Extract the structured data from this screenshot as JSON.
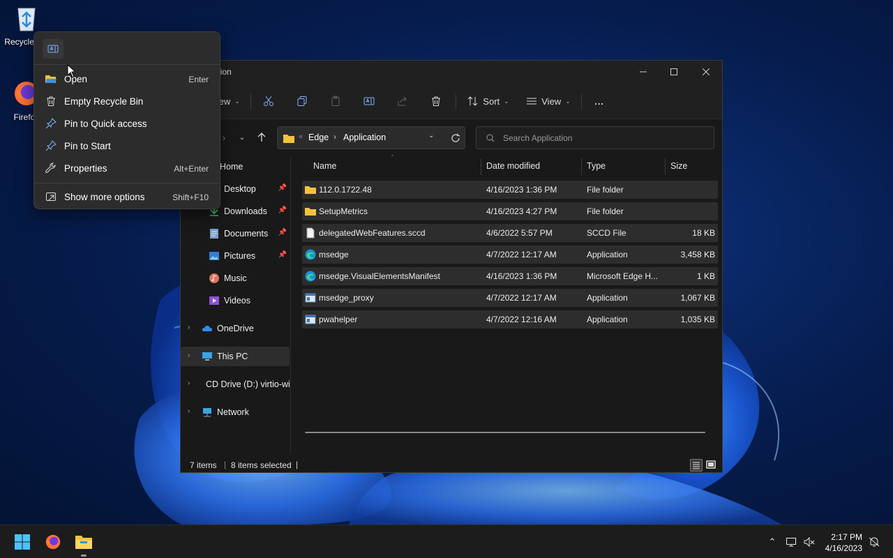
{
  "desktop": {
    "icons": [
      {
        "label": "Recycle Bin",
        "icon": "recycle-bin-icon"
      },
      {
        "label": "Firefox",
        "icon": "firefox-icon"
      }
    ]
  },
  "window": {
    "title": "Application",
    "minimize_icon": "minimize-icon",
    "maximize_icon": "maximize-icon",
    "close_icon": "close-icon"
  },
  "toolbar": {
    "new_label": "New",
    "sort_label": "Sort",
    "view_label": "View",
    "more_label": "..."
  },
  "address": {
    "overflow": "«",
    "crumbs": [
      "Edge",
      "Application"
    ],
    "separator": "›"
  },
  "search": {
    "placeholder": "Search Application"
  },
  "nav": {
    "home": "Home",
    "items": [
      {
        "label": "Desktop",
        "pinned": true
      },
      {
        "label": "Downloads",
        "pinned": true
      },
      {
        "label": "Documents",
        "pinned": true
      },
      {
        "label": "Pictures",
        "pinned": true
      },
      {
        "label": "Music",
        "pinned": false
      },
      {
        "label": "Videos",
        "pinned": false
      }
    ],
    "roots": [
      {
        "label": "OneDrive"
      },
      {
        "label": "This PC"
      },
      {
        "label": "CD Drive (D:) virtio-win"
      },
      {
        "label": "Network"
      }
    ]
  },
  "columns": {
    "name": "Name",
    "date": "Date modified",
    "type": "Type",
    "size": "Size"
  },
  "files": [
    {
      "name": "112.0.1722.48",
      "date": "4/16/2023 1:36 PM",
      "type": "File folder",
      "size": "",
      "icon": "folder-icon"
    },
    {
      "name": "SetupMetrics",
      "date": "4/16/2023 4:27 PM",
      "type": "File folder",
      "size": "",
      "icon": "folder-icon"
    },
    {
      "name": "delegatedWebFeatures.sccd",
      "date": "4/6/2022 5:57 PM",
      "type": "SCCD File",
      "size": "18 KB",
      "icon": "file-icon"
    },
    {
      "name": "msedge",
      "date": "4/7/2022 12:17 AM",
      "type": "Application",
      "size": "3,458 KB",
      "icon": "edge-icon"
    },
    {
      "name": "msedge.VisualElementsManifest",
      "date": "4/16/2023 1:36 PM",
      "type": "Microsoft Edge H...",
      "size": "1 KB",
      "icon": "edge-icon"
    },
    {
      "name": "msedge_proxy",
      "date": "4/7/2022 12:17 AM",
      "type": "Application",
      "size": "1,067 KB",
      "icon": "app-icon"
    },
    {
      "name": "pwahelper",
      "date": "4/7/2022 12:16 AM",
      "type": "Application",
      "size": "1,035 KB",
      "icon": "app-icon"
    }
  ],
  "status": {
    "items": "7 items",
    "selected": "8 items selected"
  },
  "context_menu": {
    "items": [
      {
        "label": "Open",
        "shortcut": "Enter",
        "icon": "folder-open-icon"
      },
      {
        "label": "Empty Recycle Bin",
        "shortcut": "",
        "icon": "trash-icon"
      },
      {
        "label": "Pin to Quick access",
        "shortcut": "",
        "icon": "pin-icon"
      },
      {
        "label": "Pin to Start",
        "shortcut": "",
        "icon": "pin-icon"
      },
      {
        "label": "Properties",
        "shortcut": "Alt+Enter",
        "icon": "wrench-icon"
      },
      {
        "label": "Show more options",
        "shortcut": "Shift+F10",
        "icon": "more-options-icon"
      }
    ]
  },
  "taskbar": {
    "time": "2:17 PM",
    "date": "4/16/2023"
  },
  "colors": {
    "accent": "#4cc2ff",
    "folder": "#f3c33c",
    "row_selected": "#2d2d2d"
  }
}
